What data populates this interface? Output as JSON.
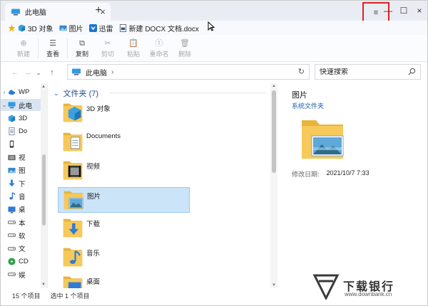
{
  "tabbar": {
    "tab_title": "此电脑",
    "close_glyph": "×",
    "new_tab_glyph": "+",
    "menu_glyph": "≡",
    "minimize_glyph": "—",
    "maximize_glyph": "☐",
    "close_window_glyph": "×"
  },
  "favorites": [
    {
      "label": "3D 对象",
      "icon": "star-icon"
    },
    {
      "label": "图片",
      "icon": "picture-icon"
    },
    {
      "label": "迅雷",
      "icon": "thunder-icon"
    },
    {
      "label": "新建 DOCX 文档.docx",
      "icon": "docx-icon"
    }
  ],
  "ribbon": {
    "buttons": [
      {
        "label": "新建",
        "icon": "⊕",
        "enabled": false
      },
      {
        "label": "查看",
        "icon": "☰",
        "enabled": true
      },
      {
        "label": "复制",
        "icon": "⧉",
        "enabled": true
      },
      {
        "label": "剪切",
        "icon": "✂",
        "enabled": false
      },
      {
        "label": "粘贴",
        "icon": "📋",
        "enabled": false
      },
      {
        "label": "重命名",
        "icon": "Ⓘ",
        "enabled": false
      },
      {
        "label": "删除",
        "icon": "🗑",
        "enabled": false
      }
    ]
  },
  "address": {
    "back_glyph": "←",
    "forward_glyph": "→",
    "dropdown_glyph": "⌄",
    "up_glyph": "↑",
    "crumb": "此电脑",
    "crumb_sep": "›",
    "refresh_glyph": "↻",
    "search_placeholder": "快速搜索"
  },
  "nav": {
    "items": [
      {
        "label": "WP",
        "expander": "›",
        "icon": "cloud-icon",
        "color": "#2f7bd6",
        "selected": false
      },
      {
        "label": "此电",
        "expander": "⌄",
        "icon": "pc-icon",
        "color": "#2f9be3",
        "selected": true
      },
      {
        "label": "3D",
        "expander": "",
        "icon": "cube-icon",
        "color": "#3aa0e0",
        "selected": false
      },
      {
        "label": "Do",
        "expander": "",
        "icon": "document-icon",
        "color": "#7a8aa0",
        "selected": false
      },
      {
        "label": "",
        "expander": "",
        "icon": "phone-icon",
        "color": "#333333",
        "selected": false
      },
      {
        "label": "视",
        "expander": "",
        "icon": "video-icon",
        "color": "#555555",
        "selected": false
      },
      {
        "label": "图",
        "expander": "",
        "icon": "picture-icon",
        "color": "#3a86c8",
        "selected": false
      },
      {
        "label": "下",
        "expander": "",
        "icon": "download-icon",
        "color": "#2f7bd6",
        "selected": false
      },
      {
        "label": "音",
        "expander": "",
        "icon": "music-icon",
        "color": "#2f7bd6",
        "selected": false
      },
      {
        "label": "桌",
        "expander": "",
        "icon": "desktop-icon",
        "color": "#2f7bd6",
        "selected": false
      },
      {
        "label": "本",
        "expander": "",
        "icon": "drive-icon",
        "color": "#555555",
        "selected": false
      },
      {
        "label": "软",
        "expander": "",
        "icon": "drive-icon",
        "color": "#555555",
        "selected": false
      },
      {
        "label": "文",
        "expander": "",
        "icon": "drive-icon",
        "color": "#555555",
        "selected": false
      },
      {
        "label": "CD",
        "expander": "",
        "icon": "cd-icon",
        "color": "#2fa24a",
        "selected": false
      },
      {
        "label": "娱",
        "expander": "",
        "icon": "drive-icon",
        "color": "#555555",
        "selected": false
      }
    ]
  },
  "content": {
    "group_title": "文件夹 (7)",
    "group_chevron": "⌄",
    "folders": [
      {
        "name": "3D 对象",
        "badge": "cube",
        "selected": false
      },
      {
        "name": "Documents",
        "badge": "document",
        "selected": false
      },
      {
        "name": "视频",
        "badge": "video",
        "selected": false
      },
      {
        "name": "图片",
        "badge": "picture",
        "selected": true
      },
      {
        "name": "下载",
        "badge": "download",
        "selected": false
      },
      {
        "name": "音乐",
        "badge": "music",
        "selected": false
      },
      {
        "name": "桌面",
        "badge": "desktop",
        "selected": false
      }
    ]
  },
  "preview": {
    "title": "图片",
    "subtitle": "系统文件夹",
    "meta_key": "修改日期:",
    "meta_value": "2021/10/7 7:33"
  },
  "status": {
    "count": "15 个项目",
    "selection": "选中 1 个项目"
  },
  "watermark": {
    "text": "下载银行",
    "url": "www.downbank.cn"
  },
  "colors": {
    "accent": "#2f7bd6",
    "selection": "#cce4f7",
    "highlight_box": "#e02020",
    "folder": "#f6c95a"
  }
}
